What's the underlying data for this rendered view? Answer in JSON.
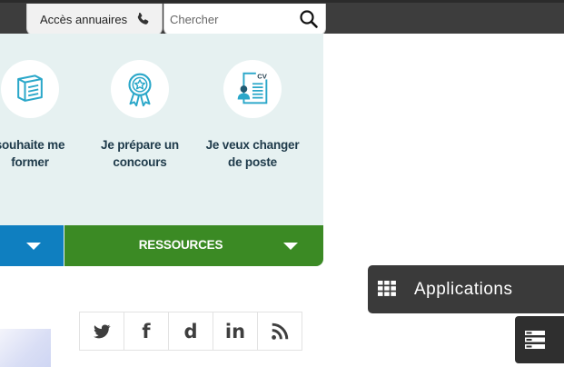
{
  "header": {
    "annuaires_label": "Accès annuaires",
    "search_placeholder": "Chercher"
  },
  "cards": [
    {
      "line1": "souhaite me",
      "line2": "former",
      "icon": "book-icon"
    },
    {
      "line1": "Je prépare un",
      "line2": "concours",
      "icon": "award-ribbon-icon"
    },
    {
      "line1": "Je veux changer",
      "line2": "de poste",
      "icon": "cv-document-icon",
      "badge": "CV"
    }
  ],
  "tabs": {
    "ressources_label": "RESSOURCES"
  },
  "apps": {
    "label": "Applications",
    "icon": "grid-icon"
  },
  "social": [
    "twitter-icon",
    "facebook-icon",
    "dailymotion-icon",
    "linkedin-icon",
    "rss-icon"
  ],
  "social_glyphs": {
    "facebook": "f",
    "dailymotion": "d",
    "linkedin": "in"
  },
  "colors": {
    "topbar": "#3d3d3d",
    "panel": "#e6f1f1",
    "blue": "#0f7fc0",
    "green": "#3b8a24",
    "apps": "#3a3a3a",
    "icon_teal": "#2aa7c9"
  }
}
